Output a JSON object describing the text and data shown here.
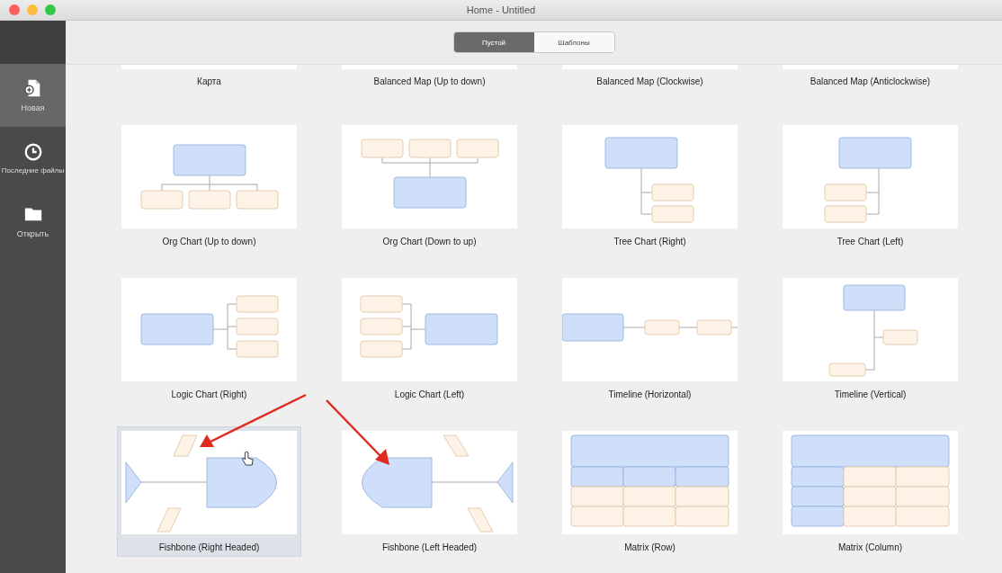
{
  "window": {
    "title": "Home - Untitled"
  },
  "sidebar": {
    "items": [
      {
        "label": "Новая",
        "kind": "new",
        "selected": true
      },
      {
        "label": "Последние файлы",
        "kind": "recent",
        "selected": false
      },
      {
        "label": "Открыть",
        "kind": "open",
        "selected": false
      }
    ]
  },
  "segments": [
    {
      "label": "Пустой",
      "selected": true
    },
    {
      "label": "Шаблоны",
      "selected": false
    }
  ],
  "templates": [
    {
      "label": "Карта",
      "kind": "cut",
      "selected": false
    },
    {
      "label": "Balanced Map (Up to down)",
      "kind": "cut",
      "selected": false
    },
    {
      "label": "Balanced Map (Clockwise)",
      "kind": "cut",
      "selected": false
    },
    {
      "label": "Balanced Map (Anticlockwise)",
      "kind": "cut",
      "selected": false
    },
    {
      "label": "Org Chart (Up to down)",
      "kind": "org-down",
      "selected": false
    },
    {
      "label": "Org Chart (Down to up)",
      "kind": "org-up",
      "selected": false
    },
    {
      "label": "Tree Chart (Right)",
      "kind": "tree-right",
      "selected": false
    },
    {
      "label": "Tree Chart (Left)",
      "kind": "tree-left",
      "selected": false
    },
    {
      "label": "Logic Chart (Right)",
      "kind": "logic-right",
      "selected": false
    },
    {
      "label": "Logic Chart (Left)",
      "kind": "logic-left",
      "selected": false
    },
    {
      "label": "Timeline (Horizontal)",
      "kind": "timeline-h",
      "selected": false
    },
    {
      "label": "Timeline (Vertical)",
      "kind": "timeline-v",
      "selected": false
    },
    {
      "label": "Fishbone (Right Headed)",
      "kind": "fish-right",
      "selected": true
    },
    {
      "label": "Fishbone (Left Headed)",
      "kind": "fish-left",
      "selected": false
    },
    {
      "label": "Matrix (Row)",
      "kind": "matrix-row",
      "selected": false
    },
    {
      "label": "Matrix (Column)",
      "kind": "matrix-col",
      "selected": false
    }
  ]
}
